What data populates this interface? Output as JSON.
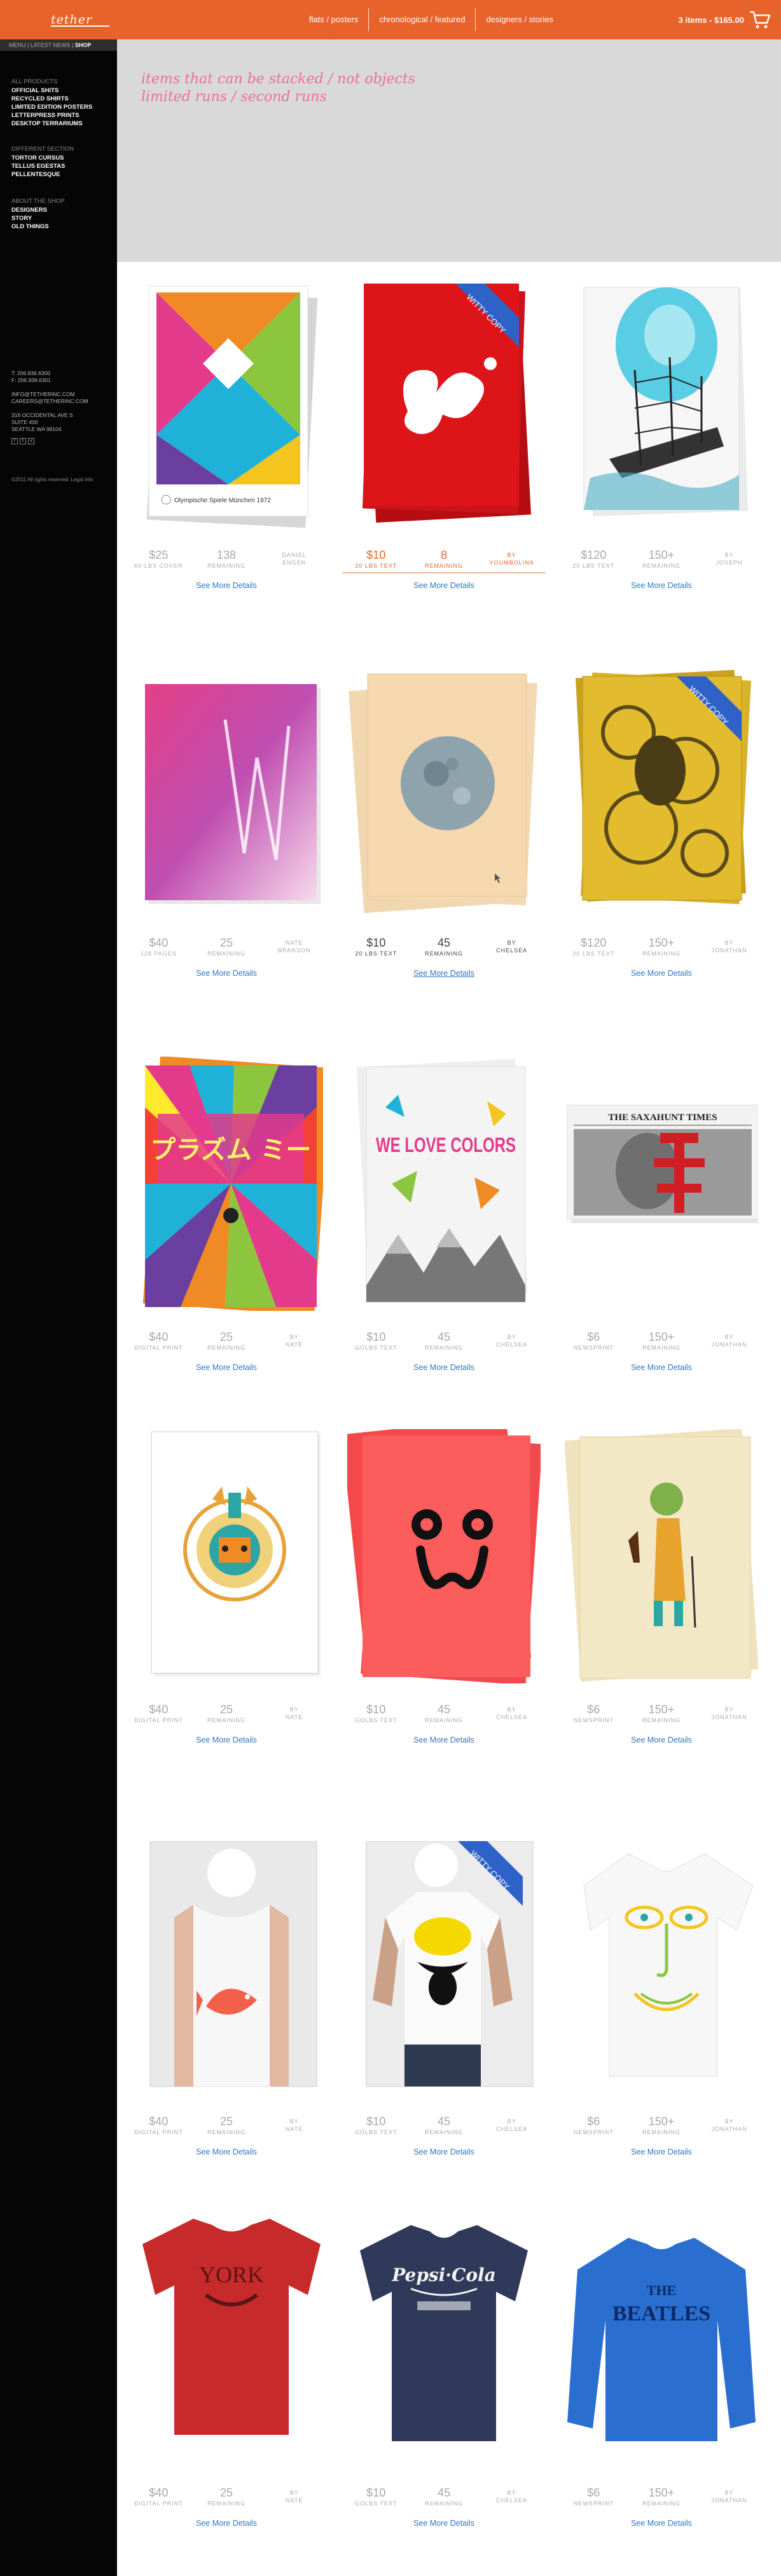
{
  "brand": {
    "logo": "tether"
  },
  "nav": {
    "items": [
      "flats / posters",
      "chronological / featured",
      "designers / stories"
    ]
  },
  "cart": {
    "summary": "3 items - $165.00",
    "icon": "cart-icon"
  },
  "breadcrumb": {
    "parts": [
      "MENU",
      "LATEST NEWS"
    ],
    "current": "SHOP"
  },
  "sidebar": {
    "group1": {
      "head": "ALL PRODUCTS",
      "links": [
        "OFFICIAL SHITS",
        "RECYCLED SHIRTS",
        "LIMITED EDITION POSTERS",
        "LETTERPRESS PRINTS",
        "DESKTOP TERRARIUMS"
      ]
    },
    "group2": {
      "head": "DIFFERENT SECTION",
      "links": [
        "TORTOR CURSUS",
        "TELLUS EGESTAS",
        "PELLENTESQUE"
      ]
    },
    "group3": {
      "head": "ABOUT THE SHOP",
      "links": [
        "DESIGNERS",
        "STORY",
        "OLD THINGS"
      ]
    },
    "contact": [
      "T: 206.938.6300",
      "F: 206.938.6301",
      "",
      "INFO@TETHERINC.COM",
      "CAREERS@TETHERINC.COM",
      "",
      "316 OCCIDENTAL AVE S",
      "SUITE 400",
      "SEATTLE WA 98104"
    ],
    "social": [
      "f",
      "t",
      "v"
    ],
    "copyright": "©2011 All rights reserved. Legal Info"
  },
  "hero": {
    "line1": "items that can be stacked / not objects",
    "line2": "limited runs / second runs"
  },
  "art": {
    "olympic_caption": "Olympische Spiele München 1972",
    "witty": "WITTY COPY",
    "times": "THE SAXAHUNT TIMES",
    "love": "WE LOVE COLORS",
    "plasma": "プラズム ミー"
  },
  "see_more": "See More Details",
  "products": [
    {
      "price": "$25",
      "paper": "60 LBS COVER",
      "remaining": "138",
      "rem_label": "REMAINING",
      "by": "DANIEL",
      "by_label": "ENGEN"
    },
    {
      "price": "$10",
      "paper": "20 LBS TEXT",
      "remaining": "8",
      "rem_label": "REMAINING",
      "by": "BY",
      "by_label": "YOUMBOLINA"
    },
    {
      "price": "$120",
      "paper": "20 LBS TEXT",
      "remaining": "150+",
      "rem_label": "REMAINING",
      "by": "BY",
      "by_label": "JOSEPH"
    },
    {
      "price": "$40",
      "paper": "128 PAGES",
      "remaining": "25",
      "rem_label": "REMAINING",
      "by": "NATE",
      "by_label": "BRANSON"
    },
    {
      "price": "$10",
      "paper": "20 LBS TEXT",
      "remaining": "45",
      "rem_label": "REMAINING",
      "by": "BY",
      "by_label": "CHELSEA"
    },
    {
      "price": "$120",
      "paper": "20 LBS TEXT",
      "remaining": "150+",
      "rem_label": "REMAINING",
      "by": "BY",
      "by_label": "JONATHAN"
    },
    {
      "price": "$40",
      "paper": "DIGITAL PRINT",
      "remaining": "25",
      "rem_label": "REMAINING",
      "by": "BY",
      "by_label": "NATE"
    },
    {
      "price": "$10",
      "paper": "GOLBS TEXT",
      "remaining": "45",
      "rem_label": "REMAINING",
      "by": "BY",
      "by_label": "CHELSEA"
    },
    {
      "price": "$6",
      "paper": "NEWSPRINT",
      "remaining": "150+",
      "rem_label": "REMAINING",
      "by": "BY",
      "by_label": "JONATHAN"
    },
    {
      "price": "$40",
      "paper": "DIGITAL PRINT",
      "remaining": "25",
      "rem_label": "REMAINING",
      "by": "BY",
      "by_label": "NATE"
    },
    {
      "price": "$10",
      "paper": "GOLBS TEXT",
      "remaining": "45",
      "rem_label": "REMAINING",
      "by": "BY",
      "by_label": "CHELSEA"
    },
    {
      "price": "$6",
      "paper": "NEWSPRINT",
      "remaining": "150+",
      "rem_label": "REMAINING",
      "by": "BY",
      "by_label": "JONATHAN"
    },
    {
      "price": "$40",
      "paper": "DIGITAL PRINT",
      "remaining": "25",
      "rem_label": "REMAINING",
      "by": "BY",
      "by_label": "NATE"
    },
    {
      "price": "$10",
      "paper": "GOLBS TEXT",
      "remaining": "45",
      "rem_label": "REMAINING",
      "by": "BY",
      "by_label": "CHELSEA"
    },
    {
      "price": "$6",
      "paper": "NEWSPRINT",
      "remaining": "150+",
      "rem_label": "REMAINING",
      "by": "BY",
      "by_label": "JONATHAN"
    },
    {
      "price": "$40",
      "paper": "DIGITAL PRINT",
      "remaining": "25",
      "rem_label": "REMAINING",
      "by": "BY",
      "by_label": "NATE"
    },
    {
      "price": "$10",
      "paper": "GOLBS TEXT",
      "remaining": "45",
      "rem_label": "REMAINING",
      "by": "BY",
      "by_label": "CHELSEA"
    },
    {
      "price": "$6",
      "paper": "NEWSPRINT",
      "remaining": "150+",
      "rem_label": "REMAINING",
      "by": "BY",
      "by_label": "JONATHAN"
    }
  ],
  "colors": {
    "accent": "#e8632b",
    "link": "#2f77c9",
    "hero_text": "#f06c9b",
    "ribbon": "#2f62c9"
  }
}
